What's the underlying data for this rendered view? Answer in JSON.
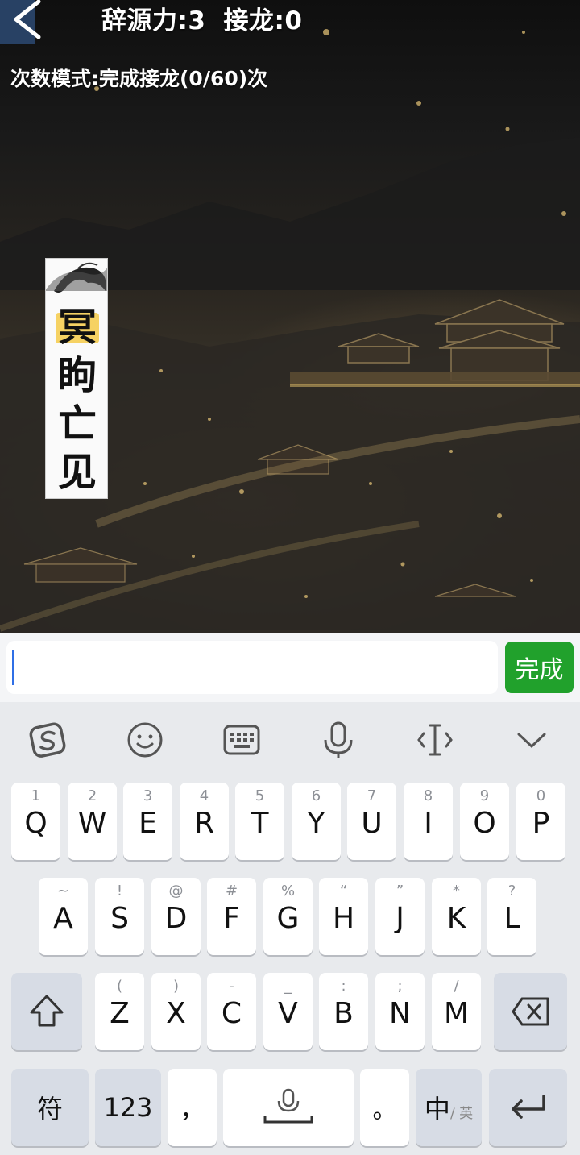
{
  "header": {
    "back_icon": "chevron-left-icon",
    "cifa_label": "辞源力:3",
    "jielong_label": "接龙:0",
    "mode_text": "次数模式:完成接龙(0/60)次"
  },
  "idiom_card": {
    "chars": [
      "冥",
      "眗",
      "亡",
      "见"
    ],
    "highlight_color": "#f4c430"
  },
  "input": {
    "value": "",
    "placeholder": "",
    "done_label": "完成",
    "done_color": "#21a12c"
  },
  "keyboard": {
    "toolbar_icons": [
      "sogou-logo-icon",
      "emoji-icon",
      "keyboard-icon",
      "microphone-icon",
      "cursor-move-icon",
      "collapse-chevron-icon"
    ],
    "row1": [
      {
        "sub": "1",
        "main": "Q"
      },
      {
        "sub": "2",
        "main": "W"
      },
      {
        "sub": "3",
        "main": "E"
      },
      {
        "sub": "4",
        "main": "R"
      },
      {
        "sub": "5",
        "main": "T"
      },
      {
        "sub": "6",
        "main": "Y"
      },
      {
        "sub": "7",
        "main": "U"
      },
      {
        "sub": "8",
        "main": "I"
      },
      {
        "sub": "9",
        "main": "O"
      },
      {
        "sub": "0",
        "main": "P"
      }
    ],
    "row2": [
      {
        "sub": "~",
        "main": "A"
      },
      {
        "sub": "!",
        "main": "S"
      },
      {
        "sub": "@",
        "main": "D"
      },
      {
        "sub": "#",
        "main": "F"
      },
      {
        "sub": "%",
        "main": "G"
      },
      {
        "sub": "“",
        "main": "H"
      },
      {
        "sub": "”",
        "main": "J"
      },
      {
        "sub": "*",
        "main": "K"
      },
      {
        "sub": "?",
        "main": "L"
      }
    ],
    "row3": [
      {
        "sub": "(",
        "main": "Z"
      },
      {
        "sub": ")",
        "main": "X"
      },
      {
        "sub": "-",
        "main": "C"
      },
      {
        "sub": "_",
        "main": "V"
      },
      {
        "sub": ":",
        "main": "B"
      },
      {
        "sub": ";",
        "main": "N"
      },
      {
        "sub": "/",
        "main": "M"
      }
    ],
    "symbols_label": "符",
    "numbers_label": "123",
    "comma_label": "，",
    "period_label": "。",
    "lang_main": "中",
    "lang_sub": "/ 英"
  }
}
